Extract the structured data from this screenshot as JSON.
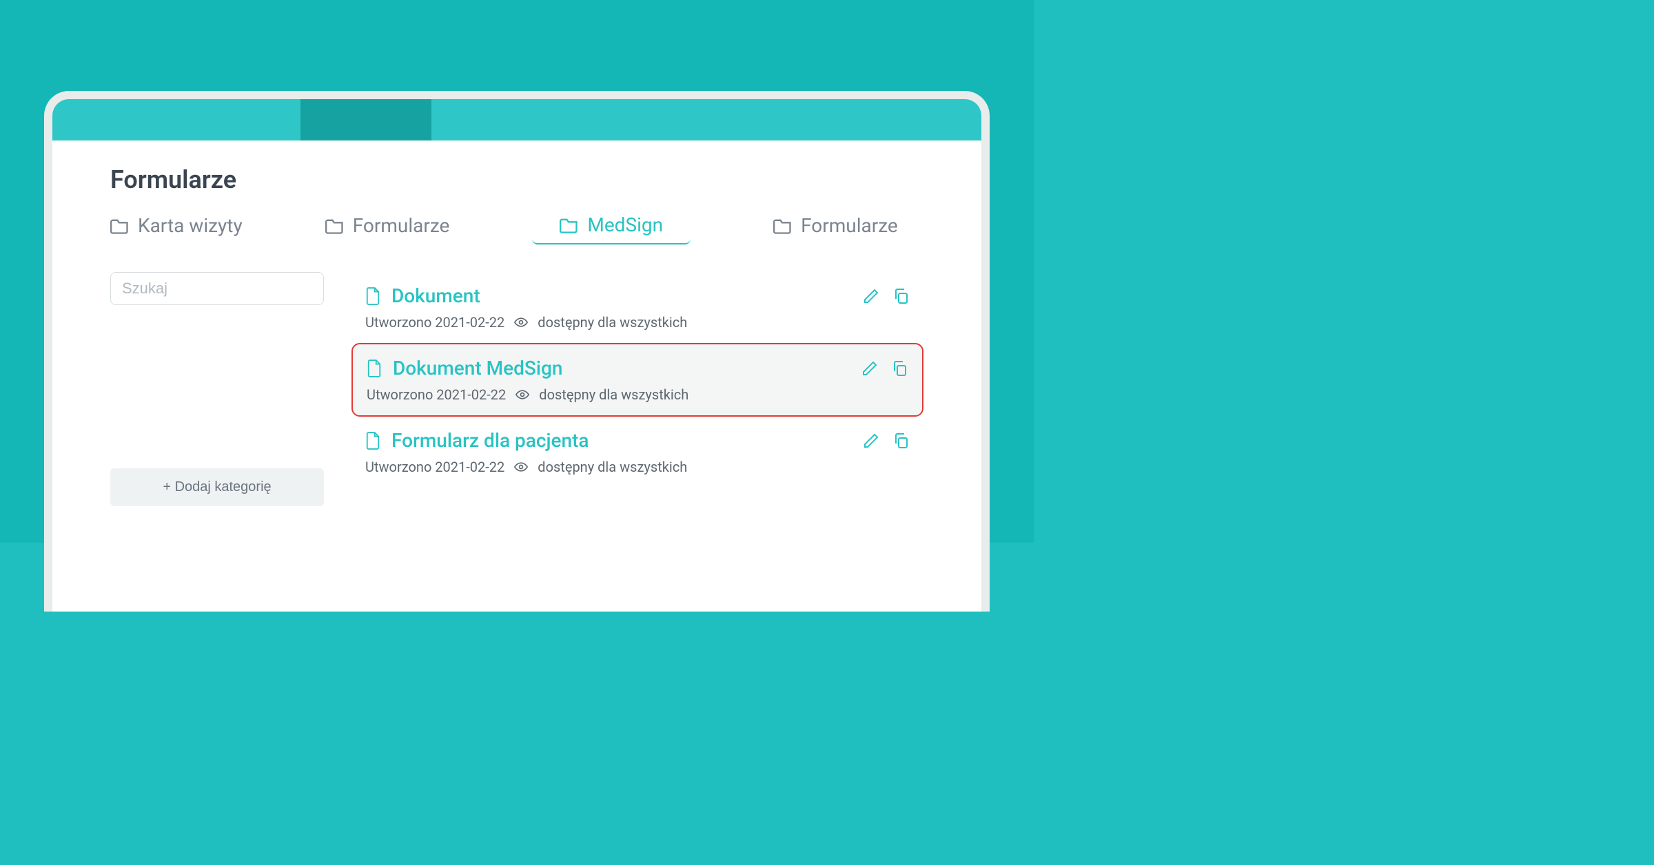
{
  "page": {
    "title": "Formularze"
  },
  "tabs": [
    {
      "label": "Karta wizyty",
      "active": false
    },
    {
      "label": "Formularze",
      "active": false
    },
    {
      "label": "MedSign",
      "active": true
    },
    {
      "label": "Formularze",
      "active": false
    }
  ],
  "search": {
    "placeholder": "Szukaj"
  },
  "add_category_label": "+ Dodaj kategorię",
  "created_prefix": "Utworzono",
  "visibility_label": "dostępny dla wszystkich",
  "items": [
    {
      "title": "Dokument",
      "created": "2021-02-22",
      "highlighted": false
    },
    {
      "title": "Dokument MedSign",
      "created": "2021-02-22",
      "highlighted": true
    },
    {
      "title": "Formularz dla pacjenta",
      "created": "2021-02-22",
      "highlighted": false
    }
  ]
}
